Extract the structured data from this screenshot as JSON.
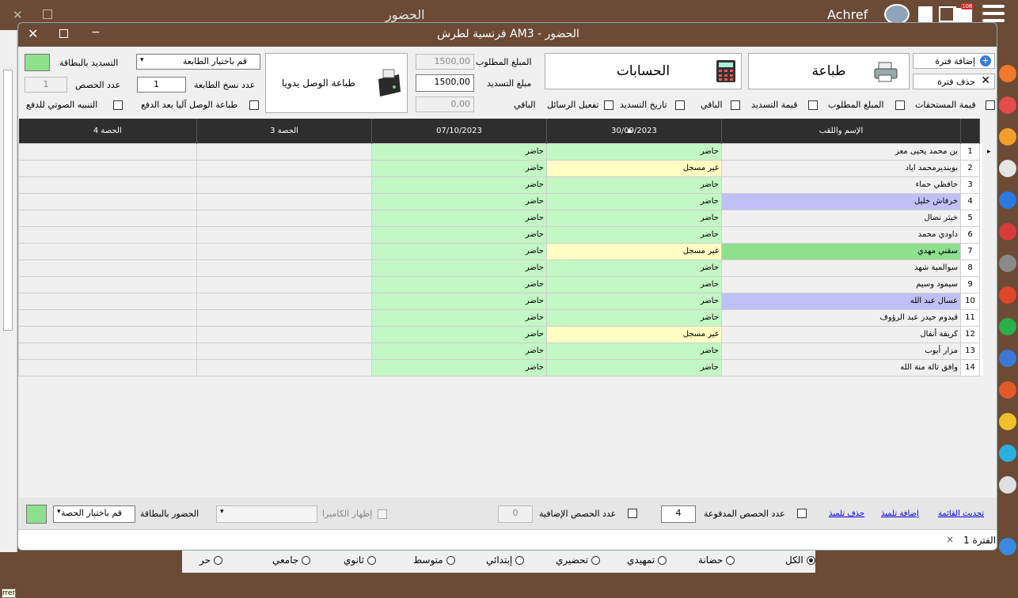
{
  "outer": {
    "title": "الحضور",
    "user": "Achref",
    "badge": "108",
    "tooltip": "rrer"
  },
  "window": {
    "title": "فرنسية لطرش AMالحضور - 3",
    "close": "✕",
    "minimize": "−"
  },
  "top": {
    "add_period": "إضافة فترة",
    "delete_period": "حذف فترة",
    "print": "طباعة",
    "accounts": "الحسابات",
    "required_amount_label": "المبلغ المطلوب",
    "required_amount": "1500,00",
    "payment_amount_label": "مبلغ التسديد",
    "payment_amount": "1500,00",
    "remaining_label": "الباقي",
    "remaining": "0,00",
    "manual_receipt": "طباعة الوصل يدويا",
    "printer_select": "قم باختيار الطابعة",
    "copies_label": "عدد نسخ الطابعة",
    "copies": "1",
    "auto_print": "طباعة الوصل آليا بعد الدفع",
    "card_payment": "التسديد بالبطاقة",
    "sessions_count_label": "عدد الحصص",
    "sessions_count": "1",
    "audio_alert": "التنبيه الصوتي للدفع",
    "checks": [
      "قيمة المستحقات",
      "المبلغ المطلوب",
      "قيمة التسديد",
      "الباقي",
      "تاريخ التسديد",
      "تفعيل الرسائل"
    ]
  },
  "table": {
    "headers": [
      "الإسم واللقب",
      "30/09/2023",
      "07/10/2023",
      "الحصة 3",
      "الحصة 4"
    ],
    "rows": [
      {
        "n": "1",
        "name": "بن محمد يحيى معز",
        "d1": "حاضر",
        "d2": "حاضر"
      },
      {
        "n": "2",
        "name": "بوبنديرمحمد اياد",
        "d1": "غير مسجل",
        "d2": "حاضر"
      },
      {
        "n": "3",
        "name": "حافظي حماء",
        "d1": "حاضر",
        "d2": "حاضر"
      },
      {
        "n": "4",
        "name": "خرفاش خليل",
        "d1": "حاضر",
        "d2": "حاضر"
      },
      {
        "n": "5",
        "name": "خيثر نضال",
        "d1": "حاضر",
        "d2": "حاضر"
      },
      {
        "n": "6",
        "name": "داودي محمد",
        "d1": "حاضر",
        "d2": "حاضر"
      },
      {
        "n": "7",
        "name": "سقني مهدي",
        "d1": "غير مسجل",
        "d2": "حاضر"
      },
      {
        "n": "8",
        "name": "سوالمية شهد",
        "d1": "حاضر",
        "d2": "حاضر"
      },
      {
        "n": "9",
        "name": "سيمود وسيم",
        "d1": "حاضر",
        "d2": "حاضر"
      },
      {
        "n": "10",
        "name": "عسال عبد الله",
        "d1": "حاضر",
        "d2": "حاضر"
      },
      {
        "n": "11",
        "name": "قيدوم حيدر عبد الرؤوف",
        "d1": "حاضر",
        "d2": "حاضر"
      },
      {
        "n": "12",
        "name": "كريفة أنفال",
        "d1": "غير مسجل",
        "d2": "حاضر"
      },
      {
        "n": "13",
        "name": "مزار أيوب",
        "d1": "حاضر",
        "d2": "حاضر"
      },
      {
        "n": "14",
        "name": "وافق تالة منة الله",
        "d1": "حاضر",
        "d2": "حاضر"
      }
    ]
  },
  "bottom": {
    "refresh": "تحديث القائمة",
    "add_student": "إضافة تلميذ",
    "delete_student": "حذف تلميذ",
    "paid_sessions_label": "عدد الحصص المدفوعة",
    "paid_sessions": "4",
    "extra_sessions_label": "عدد الحصص الإضافية",
    "extra_sessions": "0",
    "show_camera": "إظهار الكاميرا",
    "card_attendance": "الحضور بالبطاقة",
    "session_select": "قم باختيار الحصة"
  },
  "period_tab": "الفترة 1",
  "levels": [
    "الكل",
    "حضانة",
    "تمهيدي",
    "تحضيري",
    "إبتدائي",
    "متوسط",
    "ثانوي",
    "جامعي",
    "حر"
  ],
  "colors": {
    "brown": "#6b4a36",
    "present": "#c3f7c3",
    "unregistered": "#fffcc4",
    "highlight_blue": "#c0c0f7",
    "highlight_green": "#8ee08e"
  }
}
